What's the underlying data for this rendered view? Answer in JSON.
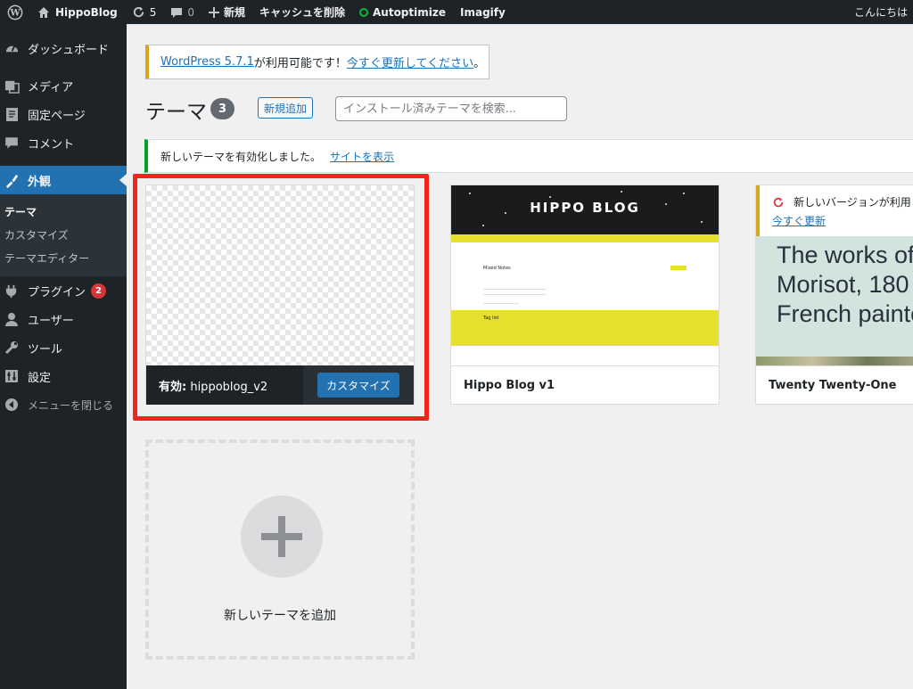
{
  "adminbar": {
    "wp_logo": "wordpress-icon",
    "site_name": "HippoBlog",
    "updates_count": "5",
    "comments_count": "0",
    "new_label": "新規",
    "clear_cache": "キャッシュを削除",
    "autoptimize": "Autoptimize",
    "imagify": "Imagify",
    "greeting": "こんにちは"
  },
  "sidebar": {
    "items": [
      {
        "label": "ダッシュボード",
        "icon": "dashboard-icon"
      },
      {
        "label": "メディア",
        "icon": "media-icon"
      },
      {
        "label": "固定ページ",
        "icon": "page-icon"
      },
      {
        "label": "コメント",
        "icon": "comment-icon"
      },
      {
        "label": "外観",
        "icon": "appearance-icon"
      },
      {
        "label": "プラグイン",
        "icon": "plugin-icon",
        "badge": "2"
      },
      {
        "label": "ユーザー",
        "icon": "user-icon"
      },
      {
        "label": "ツール",
        "icon": "tool-icon"
      },
      {
        "label": "設定",
        "icon": "settings-icon"
      },
      {
        "label": "メニューを閉じる",
        "icon": "collapse-icon"
      }
    ],
    "submenu": [
      "テーマ",
      "カスタマイズ",
      "テーマエディター"
    ]
  },
  "notices": {
    "update_link": "WordPress 5.7.1",
    "update_text": " が利用可能です！",
    "update_now": "今すぐ更新してください",
    "update_end": "。",
    "activated_text": "新しいテーマを有効化しました。",
    "view_site": "サイトを表示"
  },
  "header": {
    "title": "テーマ",
    "count": "3",
    "add_new": "新規追加",
    "search_placeholder": "インストール済みテーマを検索..."
  },
  "themes": {
    "active": {
      "prefix": "有効:",
      "name": " hippoblog_v2",
      "customize": "カスタマイズ"
    },
    "hippo": {
      "name": "Hippo Blog v1",
      "preview_logo": "HIPPO BLOG",
      "preview_post": "Mixed Notes",
      "preview_footer": "Tag list"
    },
    "tto": {
      "name": "Twenty Twenty-One",
      "update_text": "新しいバージョンが利用",
      "update_link": "今すぐ更新",
      "preview_lines": [
        "The works of",
        "Morisot, 180",
        "French painte"
      ]
    },
    "add_new": "新しいテーマを追加"
  },
  "colors": {
    "admin_dark": "#1d2327",
    "accent_blue": "#2271b1",
    "highlight": "#f4241c",
    "hippo_yellow": "#e6e02d"
  }
}
